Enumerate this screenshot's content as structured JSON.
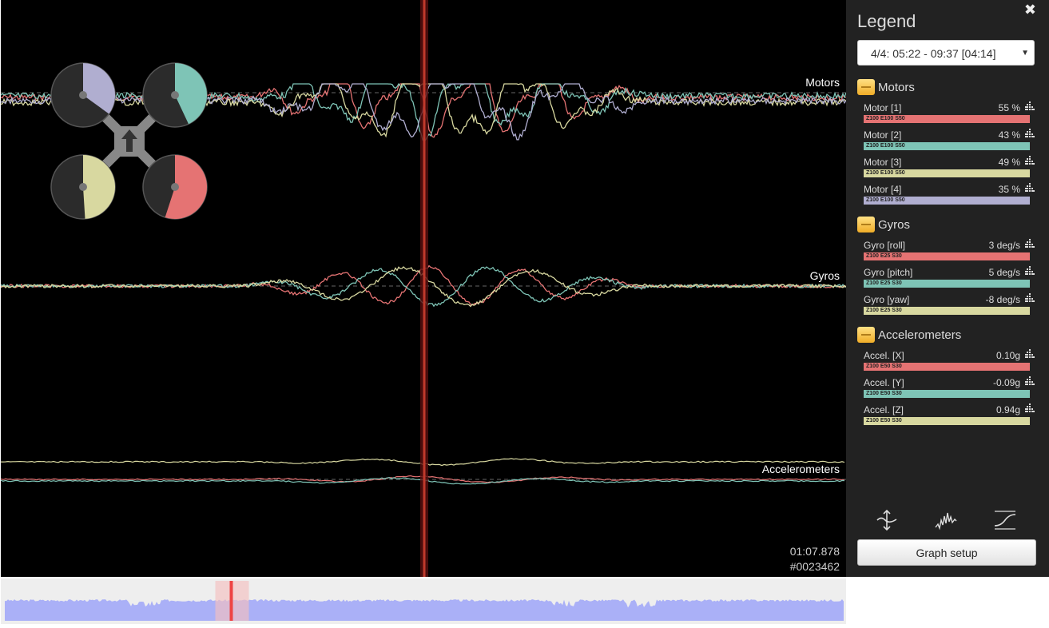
{
  "graph": {
    "labels": {
      "motors": "Motors",
      "gyros": "Gyros",
      "accelerometers": "Accelerometers"
    },
    "time": "01:07.878",
    "frame": "#0023462"
  },
  "legend": {
    "title": "Legend",
    "close_icon": "close-icon",
    "log_selector": "4/4: 05:22 - 09:37 [04:14]",
    "groups": [
      {
        "name": "Motors",
        "fields": [
          {
            "name": "Motor [1]",
            "value": "55 %",
            "setting": "Z100 E100 S50",
            "color": "#e57373"
          },
          {
            "name": "Motor [2]",
            "value": "43 %",
            "setting": "Z100 E100 S50",
            "color": "#7ec4b6"
          },
          {
            "name": "Motor [3]",
            "value": "49 %",
            "setting": "Z100 E100 S50",
            "color": "#d8d8a0"
          },
          {
            "name": "Motor [4]",
            "value": "35 %",
            "setting": "Z100 E100 S50",
            "color": "#b0aed0"
          }
        ]
      },
      {
        "name": "Gyros",
        "fields": [
          {
            "name": "Gyro [roll]",
            "value": "3 deg/s",
            "setting": "Z100 E25 S30",
            "color": "#e57373"
          },
          {
            "name": "Gyro [pitch]",
            "value": "5 deg/s",
            "setting": "Z100 E25 S30",
            "color": "#7ec4b6"
          },
          {
            "name": "Gyro [yaw]",
            "value": "-8 deg/s",
            "setting": "Z100 E25 S30",
            "color": "#d8d8a0"
          }
        ]
      },
      {
        "name": "Accelerometers",
        "fields": [
          {
            "name": "Accel. [X]",
            "value": "0.10g",
            "setting": "Z100 E50 S30",
            "color": "#e57373"
          },
          {
            "name": "Accel. [Y]",
            "value": "-0.09g",
            "setting": "Z100 E50 S30",
            "color": "#7ec4b6"
          },
          {
            "name": "Accel. [Z]",
            "value": "0.94g",
            "setting": "Z100 E50 S30",
            "color": "#d8d8a0"
          }
        ]
      }
    ],
    "toolbar": {
      "icons": [
        "zoom-vertical-icon",
        "smoothing-icon",
        "expo-curve-icon"
      ],
      "graph_setup": "Graph setup"
    }
  },
  "craft": {
    "motor_levels": [
      0.35,
      0.43,
      0.49,
      0.55
    ],
    "motor_colors": [
      "#b0aed0",
      "#7ec4b6",
      "#d8d8a0",
      "#e57373"
    ]
  },
  "seekbar": {
    "position": 0.27,
    "window_color": "#f5c0c0",
    "marker_color": "#ee4444",
    "activity_color": "#aab0f7"
  }
}
